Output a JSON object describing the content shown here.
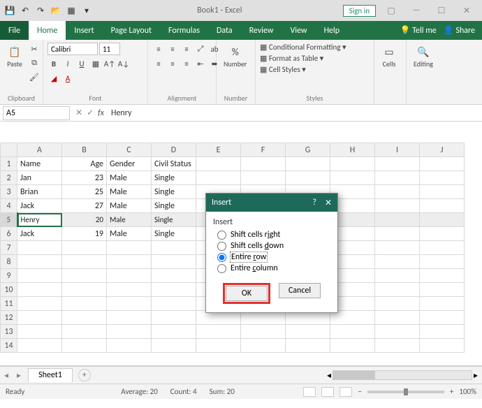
{
  "title": "Book1 - Excel",
  "signin": "Sign in",
  "tabs": {
    "file": "File",
    "home": "Home",
    "insert": "Insert",
    "pagelayout": "Page Layout",
    "formulas": "Formulas",
    "data": "Data",
    "review": "Review",
    "view": "View",
    "help": "Help",
    "tellme": "Tell me",
    "share": "Share"
  },
  "ribbon": {
    "clipboard": {
      "label": "Clipboard",
      "paste": "Paste"
    },
    "font": {
      "label": "Font",
      "name": "Calibri",
      "size": "11"
    },
    "alignment": {
      "label": "Alignment"
    },
    "number": {
      "label": "Number",
      "fmt": "%",
      "btn": "Number"
    },
    "styles": {
      "label": "Styles",
      "cond": "Conditional Formatting",
      "table": "Format as Table",
      "cell": "Cell Styles"
    },
    "cells": {
      "label": "Cells"
    },
    "editing": {
      "label": "Editing"
    }
  },
  "namebox": "A5",
  "fmla": "Henry",
  "columns": [
    "A",
    "B",
    "C",
    "D",
    "E",
    "F",
    "G",
    "H",
    "I",
    "J"
  ],
  "rows": [
    {
      "n": "1",
      "c": [
        "Name",
        "Age",
        "Gender",
        "Civil Status",
        "",
        "",
        "",
        "",
        "",
        ""
      ]
    },
    {
      "n": "2",
      "c": [
        "Jan",
        "23",
        "Male",
        "Single",
        "",
        "",
        "",
        "",
        "",
        ""
      ]
    },
    {
      "n": "3",
      "c": [
        "Brian",
        "25",
        "Male",
        "Single",
        "",
        "",
        "",
        "",
        "",
        ""
      ]
    },
    {
      "n": "4",
      "c": [
        "Jack",
        "27",
        "Male",
        "Single",
        "",
        "",
        "",
        "",
        "",
        ""
      ]
    },
    {
      "n": "5",
      "c": [
        "Henry",
        "20",
        "Male",
        "Single",
        "",
        "",
        "",
        "",
        "",
        ""
      ],
      "sel": true
    },
    {
      "n": "6",
      "c": [
        "Jack",
        "19",
        "Male",
        "Single",
        "",
        "",
        "",
        "",
        "",
        ""
      ]
    },
    {
      "n": "7",
      "c": [
        "",
        "",
        "",
        "",
        "",
        "",
        "",
        "",
        "",
        ""
      ]
    },
    {
      "n": "8",
      "c": [
        "",
        "",
        "",
        "",
        "",
        "",
        "",
        "",
        "",
        ""
      ]
    },
    {
      "n": "9",
      "c": [
        "",
        "",
        "",
        "",
        "",
        "",
        "",
        "",
        "",
        ""
      ]
    },
    {
      "n": "10",
      "c": [
        "",
        "",
        "",
        "",
        "",
        "",
        "",
        "",
        "",
        ""
      ]
    },
    {
      "n": "11",
      "c": [
        "",
        "",
        "",
        "",
        "",
        "",
        "",
        "",
        "",
        ""
      ]
    },
    {
      "n": "12",
      "c": [
        "",
        "",
        "",
        "",
        "",
        "",
        "",
        "",
        "",
        ""
      ]
    },
    {
      "n": "13",
      "c": [
        "",
        "",
        "",
        "",
        "",
        "",
        "",
        "",
        "",
        ""
      ]
    },
    {
      "n": "14",
      "c": [
        "",
        "",
        "",
        "",
        "",
        "",
        "",
        "",
        "",
        ""
      ]
    }
  ],
  "sheet_tab": "Sheet1",
  "status": {
    "mode": "Ready",
    "avg": "Average: 20",
    "count": "Count: 4",
    "sum": "Sum: 20",
    "zoom": "100%"
  },
  "dialog": {
    "title": "Insert",
    "group": "Insert",
    "opt1": "Shift cells right",
    "opt2": "Shift cells down",
    "opt3": "Entire row",
    "opt4": "Entire column",
    "ok": "OK",
    "cancel": "Cancel"
  }
}
